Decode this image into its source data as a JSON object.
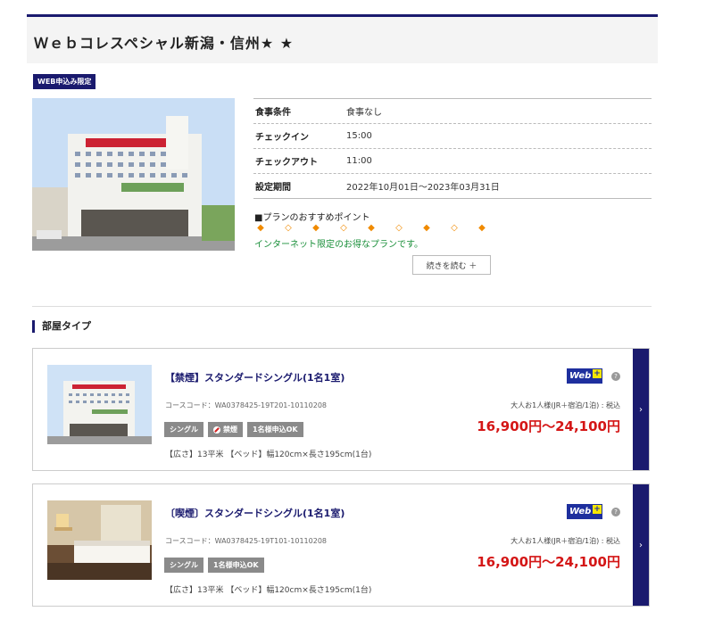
{
  "plan": {
    "title": "Ｗｅｂコレスペシャル新潟・信州★ ★",
    "badge": "WEB申込み限定",
    "info": [
      {
        "label": "食事条件",
        "value": "食事なし"
      },
      {
        "label": "チェックイン",
        "value": "15:00"
      },
      {
        "label": "チェックアウト",
        "value": "11:00"
      },
      {
        "label": "設定期間",
        "value": "2022年10月01日〜2023年03月31日"
      }
    ],
    "recommend_title": "■プランのおすすめポイント",
    "diamonds": [
      "◆",
      "◇",
      "◆",
      "◇",
      "◆",
      "◇",
      "◆",
      "◇",
      "◆"
    ],
    "recommend_text": "インターネット限定のお得なプランです。",
    "more_label": "続きを読む ＋"
  },
  "section": {
    "title": "部屋タイプ"
  },
  "rooms": [
    {
      "title": "【禁煙】スタンダードシングル(1名1室)",
      "code": "コースコード：WA0378425-19T201-10110208",
      "tags": [
        "シングル",
        "禁煙",
        "1名様申込OK"
      ],
      "spec": "【広さ】13平米 【ベッド】幅120cm×長さ195cm(1台)",
      "price_label": "大人お1人様(JR＋宿泊/1泊) : 税込",
      "price": "16,900円〜24,100円",
      "logo_text": "Web",
      "logo_plus": "+",
      "help_icon": "?"
    },
    {
      "title": "〔喫煙〕スタンダードシングル(1名1室)",
      "code": "コースコード：WA0378425-19T101-10110208",
      "tags": [
        "シングル",
        "1名様申込OK"
      ],
      "spec": "【広さ】13平米 【ベッド】幅120cm×長さ195cm(1台)",
      "price_label": "大人お1人様(JR＋宿泊/1泊) : 税込",
      "price": "16,900円〜24,100円",
      "logo_text": "Web",
      "logo_plus": "+",
      "help_icon": "?"
    }
  ],
  "icons": {
    "chevron": "›",
    "no_smoking": "no-smoking-icon"
  },
  "colors": {
    "navy": "#1a1a6e",
    "price_red": "#d41616",
    "green": "#1a8f3a",
    "orange": "#f08a00"
  }
}
